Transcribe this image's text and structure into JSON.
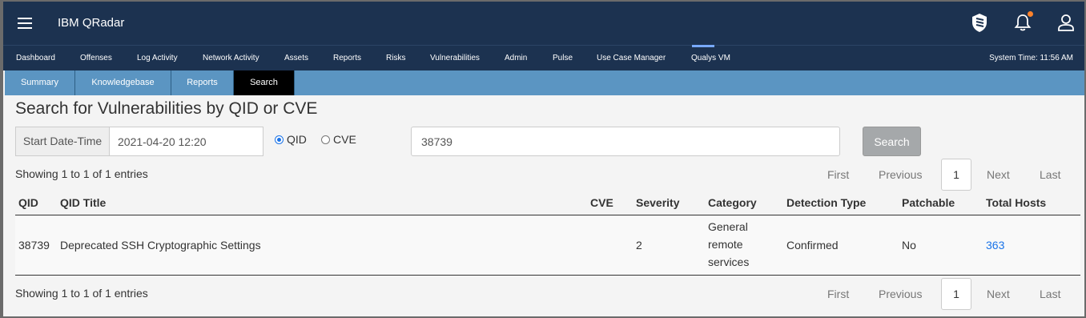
{
  "header": {
    "app_title": "IBM QRadar",
    "icons": [
      "menu-icon",
      "shield-app-icon",
      "notification-bell-icon",
      "user-profile-icon"
    ],
    "notification_dot_color": "#ff832b"
  },
  "nav": {
    "items": [
      "Dashboard",
      "Offenses",
      "Log Activity",
      "Network Activity",
      "Assets",
      "Reports",
      "Risks",
      "Vulnerabilities",
      "Admin",
      "Pulse",
      "Use Case Manager",
      "Qualys VM"
    ],
    "active": "Qualys VM",
    "system_time": "System Time: 11:56 AM"
  },
  "subtabs": {
    "items": [
      "Summary",
      "Knowledgebase",
      "Reports",
      "Search"
    ],
    "active": "Search"
  },
  "search": {
    "title": "Search for Vulnerabilities by QID or CVE",
    "date_label": "Start Date-Time",
    "date_value": "2021-04-20 12:20",
    "radio_qid": "QID",
    "radio_cve": "CVE",
    "selected_type": "QID",
    "query_value": "38739",
    "button_label": "Search"
  },
  "pagination": {
    "info": "Showing 1 to 1 of 1 entries",
    "first": "First",
    "previous": "Previous",
    "current": "1",
    "next": "Next",
    "last": "Last"
  },
  "table": {
    "columns": [
      "QID",
      "QID Title",
      "CVE",
      "Severity",
      "Category",
      "Detection Type",
      "Patchable",
      "Total Hosts"
    ],
    "rows": [
      {
        "qid": "38739",
        "title": "Deprecated SSH Cryptographic Settings",
        "cve": "",
        "severity": "2",
        "category_line1": "General",
        "category_line2": "remote",
        "category_line3": "services",
        "detection_type": "Confirmed",
        "patchable": "No",
        "total_hosts": "363"
      }
    ]
  }
}
